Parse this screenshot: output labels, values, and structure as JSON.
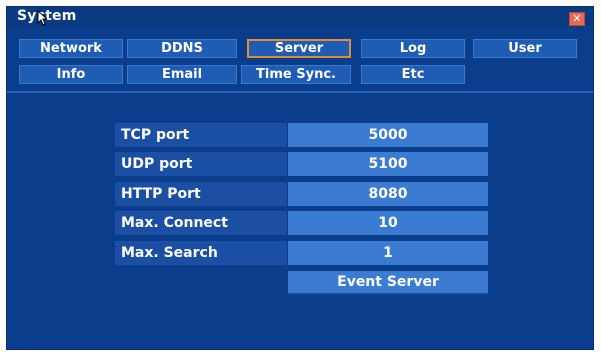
{
  "window": {
    "title": "System",
    "close_icon": "close-icon"
  },
  "tabs": {
    "row1": [
      {
        "label": "Network",
        "active": false
      },
      {
        "label": "DDNS",
        "active": false
      },
      {
        "label": "Server",
        "active": true
      },
      {
        "label": "Log",
        "active": false
      },
      {
        "label": "User",
        "active": false
      }
    ],
    "row2": [
      {
        "label": "Info",
        "active": false
      },
      {
        "label": "Email",
        "active": false
      },
      {
        "label": "Time Sync.",
        "active": false
      },
      {
        "label": "Etc",
        "active": false
      }
    ]
  },
  "server_settings": {
    "fields": [
      {
        "label": "TCP port",
        "value": "5000"
      },
      {
        "label": "UDP port",
        "value": "5100"
      },
      {
        "label": "HTTP Port",
        "value": "8080"
      },
      {
        "label": "Max. Connect",
        "value": "10"
      },
      {
        "label": "Max. Search",
        "value": "1"
      }
    ],
    "event_server_label": "Event Server"
  },
  "colors": {
    "background": "#0a3d8c",
    "tab": "#1f5db5",
    "active_tab_border": "#e58a35",
    "value_field": "#3b7cd2"
  }
}
